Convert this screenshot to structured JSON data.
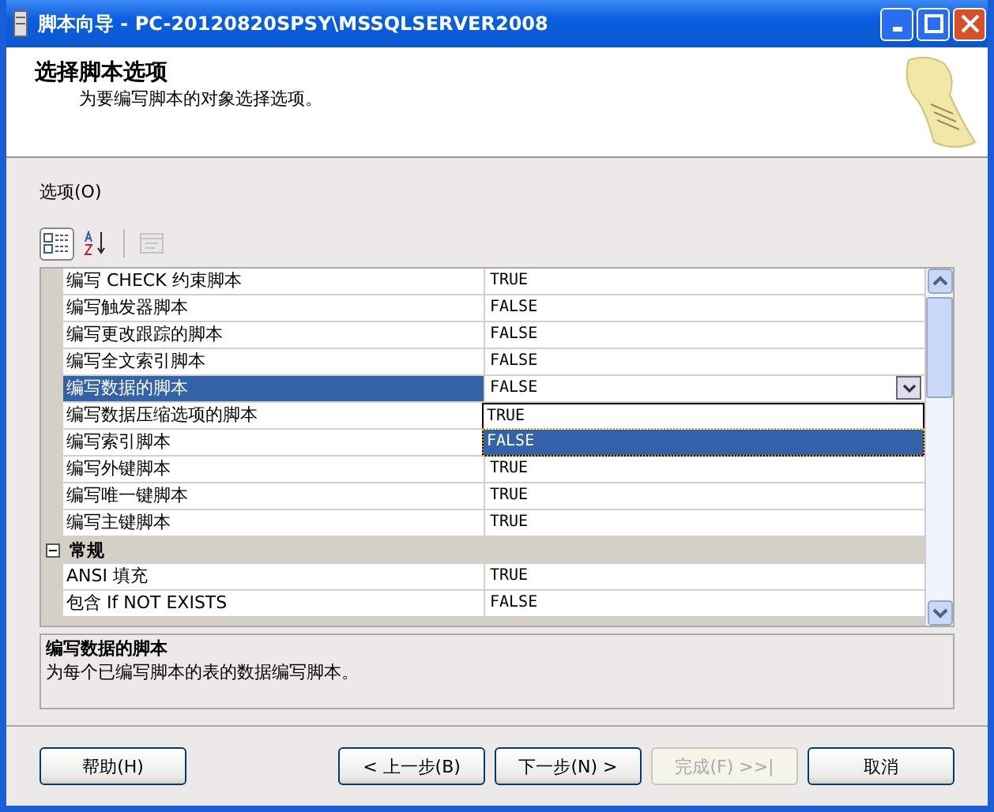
{
  "window": {
    "title": "脚本向导 - PC-20120820SPSY\\MSSQLSERVER2008"
  },
  "header": {
    "title": "选择脚本选项",
    "subtitle": "为要编写脚本的对象选择选项。"
  },
  "options_label": "选项(O)",
  "toolbar": [
    {
      "kind": "categorized",
      "selected": true,
      "disabled": false
    },
    {
      "kind": "alphabetical",
      "selected": false,
      "disabled": false
    },
    {
      "kind": "pages",
      "selected": false,
      "disabled": true
    }
  ],
  "grid": {
    "rows": [
      {
        "kind": "property",
        "name": "编写 CHECK 约束脚本",
        "value": "TRUE",
        "selected": false
      },
      {
        "kind": "property",
        "name": "编写触发器脚本",
        "value": "FALSE",
        "selected": false
      },
      {
        "kind": "property",
        "name": "编写更改跟踪的脚本",
        "value": "FALSE",
        "selected": false
      },
      {
        "kind": "property",
        "name": "编写全文索引脚本",
        "value": "FALSE",
        "selected": false
      },
      {
        "kind": "property",
        "name": "编写数据的脚本",
        "value": "FALSE",
        "selected": true
      },
      {
        "kind": "property",
        "name": "编写数据压缩选项的脚本",
        "selected": false
      },
      {
        "kind": "property",
        "name": "编写索引脚本",
        "selected": false
      },
      {
        "kind": "property",
        "name": "编写外键脚本",
        "value": "TRUE",
        "selected": false
      },
      {
        "kind": "property",
        "name": "编写唯一键脚本",
        "value": "TRUE",
        "selected": false
      },
      {
        "kind": "property",
        "name": "编写主键脚本",
        "value": "TRUE",
        "selected": false
      },
      {
        "kind": "category",
        "name": "常规",
        "expanded": true
      },
      {
        "kind": "property",
        "name": "ANSI 填充",
        "value": "TRUE",
        "selected": false
      },
      {
        "kind": "property",
        "name": "包含 If NOT EXISTS",
        "value": "FALSE",
        "selected": false
      }
    ]
  },
  "dropdown": {
    "options": [
      {
        "label": "TRUE",
        "selected": false
      },
      {
        "label": "FALSE",
        "selected": true
      }
    ]
  },
  "description": {
    "title": "编写数据的脚本",
    "text": "为每个已编写脚本的表的数据编写脚本。"
  },
  "help_button": {
    "label": "帮助(H)"
  },
  "buttons": [
    {
      "label": "< 上一步(B)",
      "disabled": false
    },
    {
      "label": "下一步(N) >",
      "disabled": false
    },
    {
      "label": "完成(F) >>|",
      "disabled": true
    },
    {
      "label": "取消",
      "disabled": false
    }
  ]
}
